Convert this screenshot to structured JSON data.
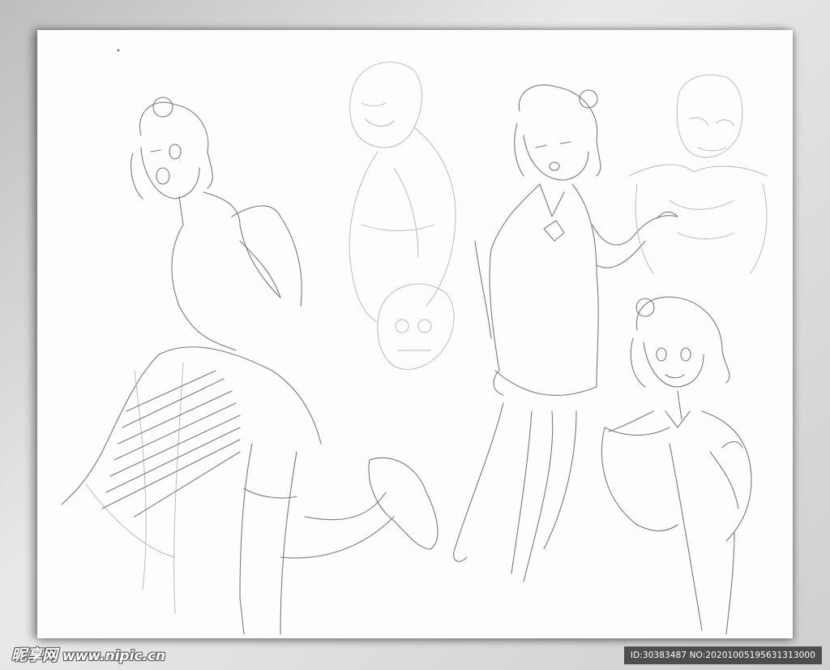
{
  "watermark": {
    "logo_text": "昵享网",
    "site_text": "www.nipic.cn",
    "id_text": "ID:30383487 NO:20201005195631313000"
  },
  "artwork": {
    "subject": "pencil-sketch-character-studies",
    "colors": {
      "paper": "#fdfdfd",
      "pencil": "#7a7a7a",
      "frame": "#d9d9d9",
      "id_bar": "#282828"
    }
  }
}
